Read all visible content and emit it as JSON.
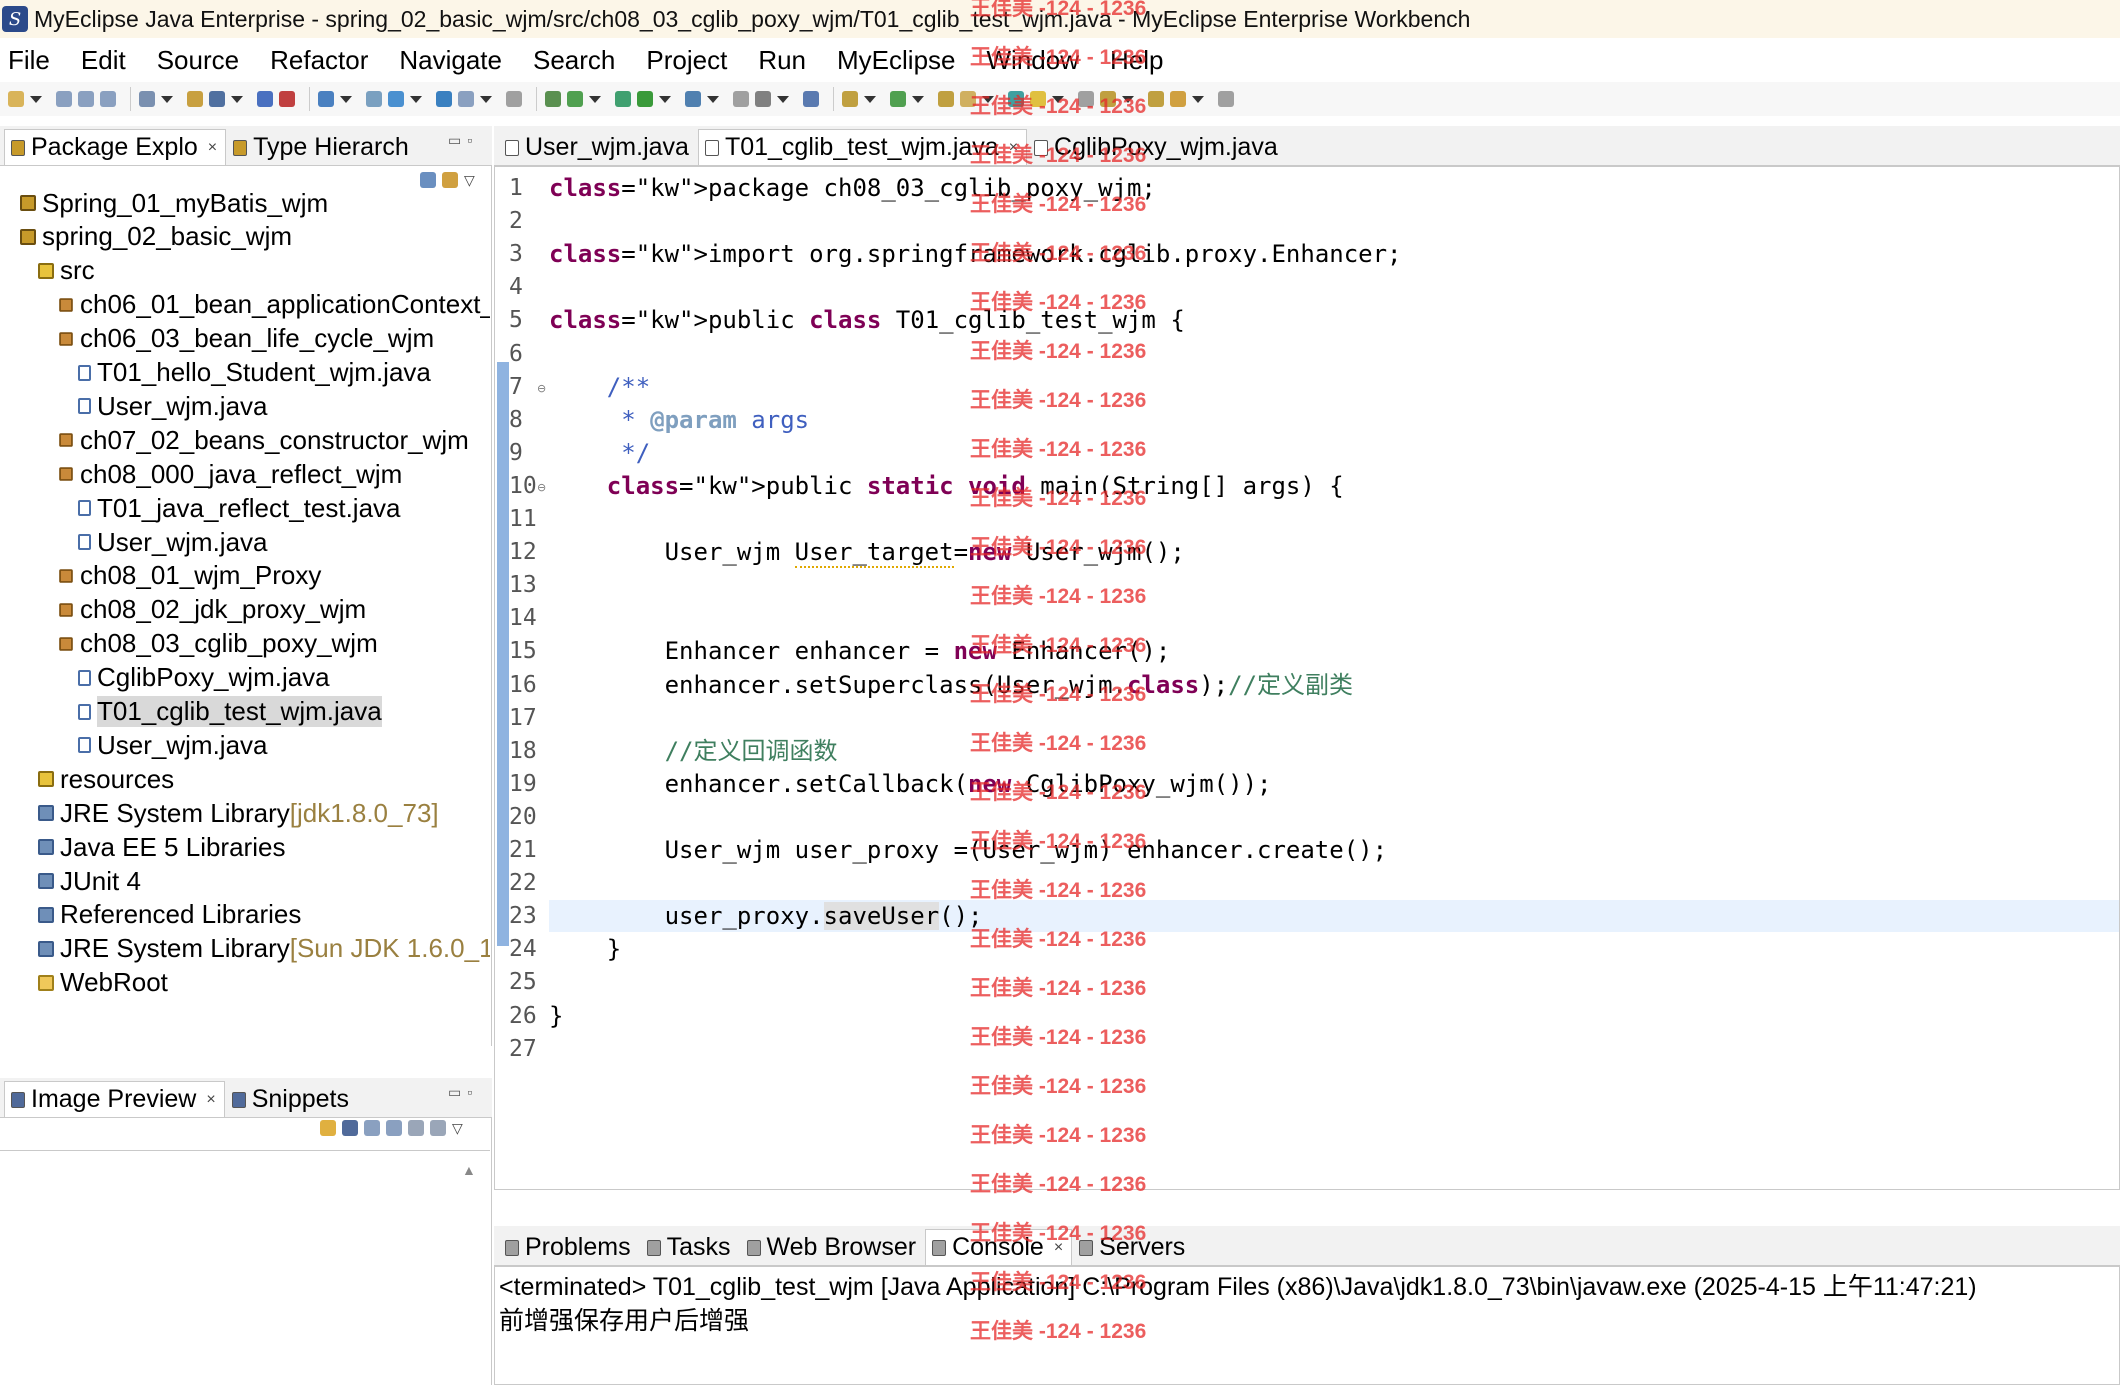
{
  "window": {
    "title": "MyEclipse Java Enterprise - spring_02_basic_wjm/src/ch08_03_cglib_poxy_wjm/T01_cglib_test_wjm.java - MyEclipse Enterprise Workbench"
  },
  "menu": [
    "File",
    "Edit",
    "Source",
    "Refactor",
    "Navigate",
    "Search",
    "Project",
    "Run",
    "MyEclipse",
    "Window",
    "Help"
  ],
  "left_panel": {
    "tabs": [
      {
        "label": "Package Explo",
        "active": true
      },
      {
        "label": "Type Hierarch",
        "active": false
      }
    ],
    "tree": [
      {
        "label": "Spring_01_myBatis_wjm",
        "level": 0,
        "icon": "project-icon"
      },
      {
        "label": "spring_02_basic_wjm",
        "level": 0,
        "icon": "project-icon"
      },
      {
        "label": "src",
        "level": 1,
        "icon": "source-folder-icon"
      },
      {
        "label": "ch06_01_bean_applicationContext_w",
        "level": 2,
        "icon": "package-icon"
      },
      {
        "label": "ch06_03_bean_life_cycle_wjm",
        "level": 2,
        "icon": "package-icon"
      },
      {
        "label": "T01_hello_Student_wjm.java",
        "level": 3,
        "icon": "java-file-icon"
      },
      {
        "label": "User_wjm.java",
        "level": 3,
        "icon": "java-file-icon"
      },
      {
        "label": "ch07_02_beans_constructor_wjm",
        "level": 2,
        "icon": "package-icon"
      },
      {
        "label": "ch08_000_java_reflect_wjm",
        "level": 2,
        "icon": "package-icon"
      },
      {
        "label": "T01_java_reflect_test.java",
        "level": 3,
        "icon": "java-file-icon"
      },
      {
        "label": "User_wjm.java",
        "level": 3,
        "icon": "java-file-icon"
      },
      {
        "label": "ch08_01_wjm_Proxy",
        "level": 2,
        "icon": "package-icon"
      },
      {
        "label": "ch08_02_jdk_proxy_wjm",
        "level": 2,
        "icon": "package-icon"
      },
      {
        "label": "ch08_03_cglib_poxy_wjm",
        "level": 2,
        "icon": "package-icon"
      },
      {
        "label": "CglibPoxy_wjm.java",
        "level": 3,
        "icon": "java-file-icon"
      },
      {
        "label": "T01_cglib_test_wjm.java",
        "level": 3,
        "icon": "java-file-icon",
        "selected": true
      },
      {
        "label": "User_wjm.java",
        "level": 3,
        "icon": "java-file-icon"
      },
      {
        "label": "resources",
        "level": 1,
        "icon": "source-folder-icon"
      },
      {
        "label": "JRE System Library",
        "suffix": "[jdk1.8.0_73]",
        "level": 1,
        "icon": "library-icon"
      },
      {
        "label": "Java EE 5 Libraries",
        "level": 1,
        "icon": "library-icon"
      },
      {
        "label": "JUnit 4",
        "level": 1,
        "icon": "library-icon"
      },
      {
        "label": "Referenced Libraries",
        "level": 1,
        "icon": "library-icon"
      },
      {
        "label": "JRE System Library",
        "suffix": "[Sun JDK 1.6.0_13]",
        "level": 1,
        "icon": "library-icon"
      },
      {
        "label": "WebRoot",
        "level": 1,
        "icon": "folder-icon"
      }
    ]
  },
  "bottom_left_panel": {
    "tabs": [
      {
        "label": "Image Preview",
        "active": true
      },
      {
        "label": "Snippets",
        "active": false
      }
    ]
  },
  "editor": {
    "tabs": [
      {
        "label": "User_wjm.java",
        "active": false
      },
      {
        "label": "T01_cglib_test_wjm.java",
        "active": true
      },
      {
        "label": "CglibPoxy_wjm.java",
        "active": false
      }
    ],
    "current_line": 23,
    "lines": [
      "package ch08_03_cglib_poxy_wjm;",
      "",
      "import org.springframework.cglib.proxy.Enhancer;",
      "",
      "public class T01_cglib_test_wjm {",
      "",
      "    /**",
      "     * @param args",
      "     */",
      "    public static void main(String[] args) {",
      "",
      "        User_wjm User_target=new User_wjm();",
      "",
      "",
      "        Enhancer enhancer = new Enhancer();",
      "        enhancer.setSuperclass(User_wjm.class);//定义副类",
      "",
      "        //定义回调函数",
      "        enhancer.setCallback(new CglibPoxy_wjm());",
      "",
      "        User_wjm user_proxy =(User_wjm) enhancer.create();",
      "",
      "        user_proxy.saveUser();",
      "    }",
      "",
      "}",
      ""
    ]
  },
  "bottom_panel": {
    "tabs": [
      {
        "label": "Problems",
        "active": false
      },
      {
        "label": "Tasks",
        "active": false
      },
      {
        "label": "Web Browser",
        "active": false
      },
      {
        "label": "Console",
        "active": true
      },
      {
        "label": "Servers",
        "active": false
      }
    ],
    "console_header": "<terminated> T01_cglib_test_wjm [Java Application] C:\\Program Files (x86)\\Java\\jdk1.8.0_73\\bin\\javaw.exe (2025-4-15 上午11:47:21)",
    "console_output": "前增强保存用户后增强"
  },
  "watermark": {
    "text": "王佳美 -124 - 1236",
    "count": 28
  }
}
